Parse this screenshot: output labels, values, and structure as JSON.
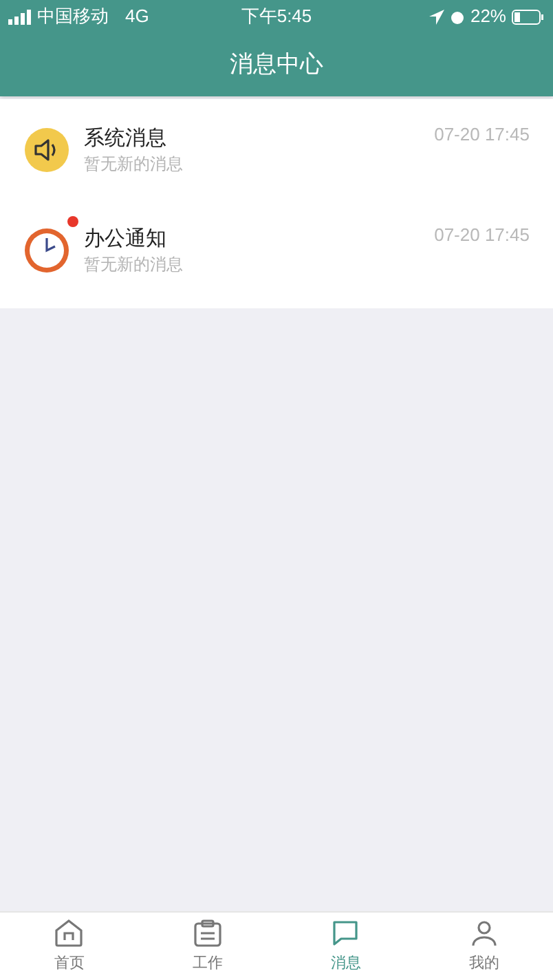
{
  "status_bar": {
    "carrier": "中国移动",
    "network": "4G",
    "time": "下午5:45",
    "battery": "22%"
  },
  "header": {
    "title": "消息中心"
  },
  "messages": [
    {
      "title": "系统消息",
      "preview": "暂无新的消息",
      "time": "07-20 17:45",
      "unread": false
    },
    {
      "title": "办公通知",
      "preview": "暂无新的消息",
      "time": "07-20 17:45",
      "unread": true
    }
  ],
  "tabs": [
    {
      "label": "首页",
      "selected": false
    },
    {
      "label": "工作",
      "selected": false
    },
    {
      "label": "消息",
      "selected": true
    },
    {
      "label": "我的",
      "selected": false
    }
  ]
}
